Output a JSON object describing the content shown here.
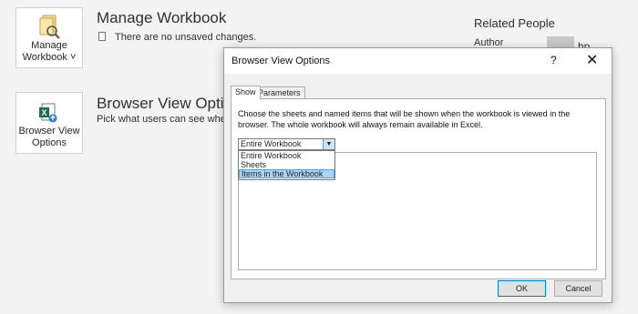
{
  "backstage": {
    "manage_workbook": {
      "button_label": "Manage Workbook ˅",
      "label_line1": "Manage",
      "label_line2": "Workbook ˅",
      "title": "Manage Workbook",
      "status_text": "There are no unsaved changes."
    },
    "browser_view": {
      "label_line1": "Browser View",
      "label_line2": "Options",
      "title": "Browser View Options",
      "description": "Pick what users can see when this"
    },
    "related_people": {
      "title": "Related People",
      "author_label": "Author",
      "author_name": "hp"
    }
  },
  "dialog": {
    "title": "Browser View Options",
    "help": "?",
    "close": "✕",
    "tabs": [
      {
        "label": "Show",
        "active": true
      },
      {
        "label": "Parameters",
        "active": false
      }
    ],
    "description": "Choose the sheets and named items that will be shown when the workbook is viewed in the browser. The whole workbook will always remain available in Excel.",
    "select": {
      "value": "Entire Workbook",
      "arrow": "▼",
      "options": [
        "Entire Workbook",
        "Sheets",
        "Items in the Workbook"
      ],
      "highlighted_index": 2
    },
    "ok_label": "OK",
    "cancel_label": "Cancel"
  },
  "colors": {
    "accent": "#0078d7",
    "highlight": "#aed3f1",
    "excel_green": "#1d6f42"
  }
}
